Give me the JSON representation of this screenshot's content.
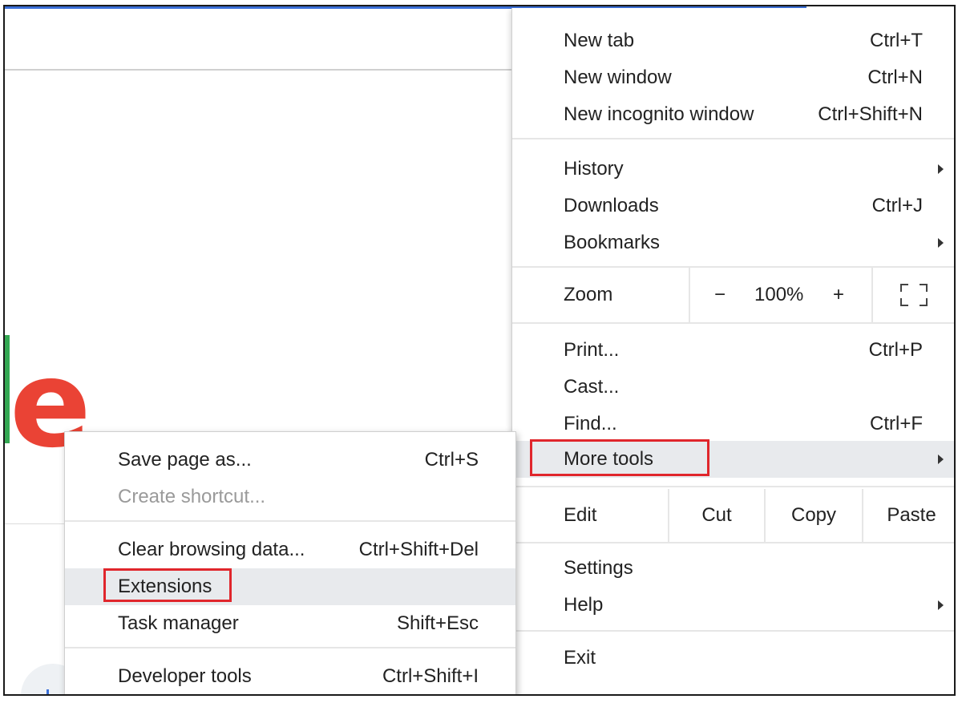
{
  "main_menu": {
    "new_tab": {
      "label": "New tab",
      "shortcut": "Ctrl+T"
    },
    "new_window": {
      "label": "New window",
      "shortcut": "Ctrl+N"
    },
    "new_incognito": {
      "label": "New incognito window",
      "shortcut": "Ctrl+Shift+N"
    },
    "history": {
      "label": "History"
    },
    "downloads": {
      "label": "Downloads",
      "shortcut": "Ctrl+J"
    },
    "bookmarks": {
      "label": "Bookmarks"
    },
    "zoom": {
      "label": "Zoom",
      "minus": "−",
      "value": "100%",
      "plus": "+"
    },
    "print": {
      "label": "Print...",
      "shortcut": "Ctrl+P"
    },
    "cast": {
      "label": "Cast..."
    },
    "find": {
      "label": "Find...",
      "shortcut": "Ctrl+F"
    },
    "more_tools": {
      "label": "More tools"
    },
    "edit": {
      "label": "Edit",
      "cut": "Cut",
      "copy": "Copy",
      "paste": "Paste"
    },
    "settings": {
      "label": "Settings"
    },
    "help": {
      "label": "Help"
    },
    "exit": {
      "label": "Exit"
    }
  },
  "sub_menu": {
    "save_page": {
      "label": "Save page as...",
      "shortcut": "Ctrl+S"
    },
    "create_shortcut": {
      "label": "Create shortcut..."
    },
    "clear_data": {
      "label": "Clear browsing data...",
      "shortcut": "Ctrl+Shift+Del"
    },
    "extensions": {
      "label": "Extensions"
    },
    "task_manager": {
      "label": "Task manager",
      "shortcut": "Shift+Esc"
    },
    "dev_tools": {
      "label": "Developer tools",
      "shortcut": "Ctrl+Shift+I"
    }
  },
  "background": {
    "logo_letter": "e"
  },
  "colors": {
    "highlight_box": "#e0262c",
    "hover_bg": "#e8eaed",
    "logo_red": "#ea4335",
    "logo_green": "#34a853"
  }
}
